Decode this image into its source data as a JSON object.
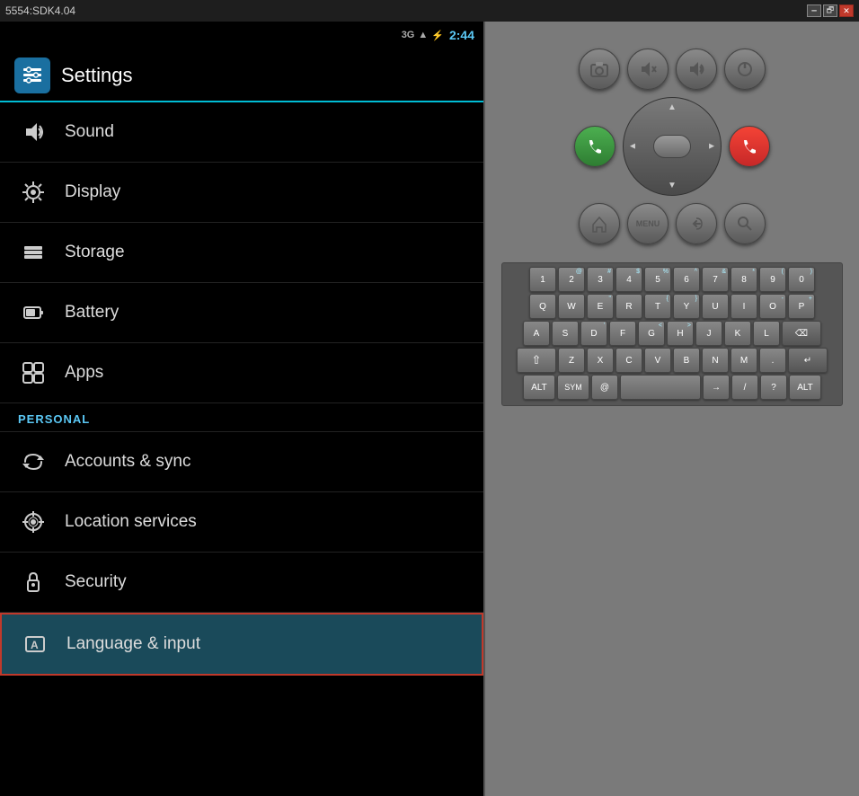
{
  "window": {
    "title": "5554:SDK4.04",
    "minimize_label": "🗕",
    "restore_label": "🗗",
    "close_label": "✕"
  },
  "status_bar": {
    "signal": "3G",
    "time": "2:44"
  },
  "header": {
    "title": "Settings"
  },
  "menu": {
    "items": [
      {
        "id": "sound",
        "label": "Sound",
        "icon": "🔊"
      },
      {
        "id": "display",
        "label": "Display",
        "icon": "✳"
      },
      {
        "id": "storage",
        "label": "Storage",
        "icon": "☰"
      },
      {
        "id": "battery",
        "label": "Battery",
        "icon": "🔋"
      },
      {
        "id": "apps",
        "label": "Apps",
        "icon": "📱"
      }
    ],
    "section_label": "PERSONAL",
    "personal_items": [
      {
        "id": "accounts-sync",
        "label": "Accounts & sync",
        "icon": "🔄"
      },
      {
        "id": "location-services",
        "label": "Location services",
        "icon": "🎯"
      },
      {
        "id": "security",
        "label": "Security",
        "icon": "🔒"
      },
      {
        "id": "language-input",
        "label": "Language & input",
        "icon": "A",
        "active": true
      }
    ]
  },
  "keyboard": {
    "rows": [
      [
        "1",
        "2",
        "3",
        "4",
        "5",
        "6",
        "7",
        "8",
        "9",
        "0"
      ],
      [
        "Q",
        "W",
        "E",
        "R",
        "T",
        "Y",
        "U",
        "I",
        "O",
        "P"
      ],
      [
        "A",
        "S",
        "D",
        "F",
        "G",
        "H",
        "J",
        "K",
        "L",
        "⌫"
      ],
      [
        "⇧",
        "Z",
        "X",
        "C",
        "V",
        "B",
        "N",
        "M",
        ".",
        "↵"
      ],
      [
        "ALT",
        "SYM",
        "@",
        "",
        "→",
        "",
        "  /  ",
        "?",
        "",
        "ALT"
      ]
    ]
  },
  "controls": {
    "top_row": [
      "📷",
      "🔇",
      "🔊",
      "⏻"
    ],
    "call": "📞",
    "end": "📵",
    "bottom_row": [
      "⌂",
      "MENU",
      "↩",
      "🔍"
    ]
  }
}
